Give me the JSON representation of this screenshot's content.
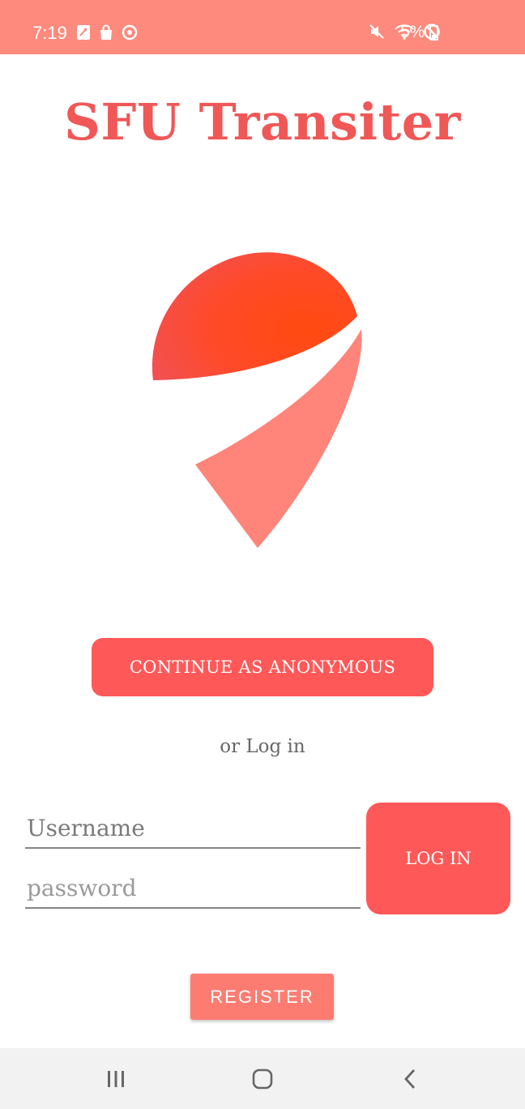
{
  "status_bar": {
    "time": "7:19",
    "battery": "5%",
    "icons_left": [
      "sync-icon",
      "shopping-bag-icon",
      "messenger-icon"
    ],
    "icons_right": [
      "mute-icon",
      "wifi-icon",
      "do-not-disturb-icon",
      "battery-icon"
    ]
  },
  "app": {
    "title": "SFU Transiter",
    "logo": "map-pin-logo",
    "accent_color": "#ff5858"
  },
  "actions": {
    "anonymous_label": "CONTINUE AS ANONYMOUS",
    "or_login_label": "or Log in",
    "login_label": "LOG IN",
    "register_label": "REGISTER"
  },
  "form": {
    "username_placeholder": "Username",
    "password_placeholder": "password"
  },
  "nav_bar": {
    "buttons": [
      "recents-icon",
      "home-icon",
      "back-icon"
    ]
  }
}
